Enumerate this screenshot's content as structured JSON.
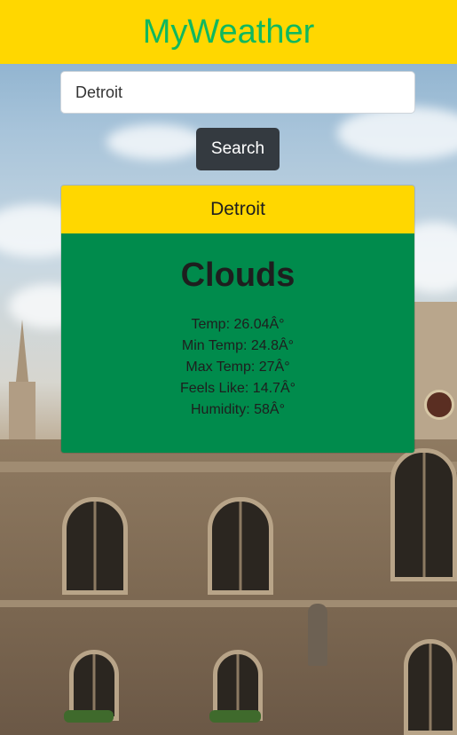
{
  "header": {
    "title": "MyWeather",
    "title_color": "#10b85e",
    "background": "#ffd700"
  },
  "search": {
    "value": "Detroit",
    "button_label": "Search"
  },
  "weather_card": {
    "city": "Detroit",
    "condition": "Clouds",
    "stats": [
      "Temp: 26.04Â°",
      "Min Temp: 24.8Â°",
      "Max Temp: 27Â°",
      "Feels Like: 14.7Â°",
      "Humidity: 58Â°"
    ],
    "header_color": "#ffd700",
    "body_color": "#008b4c"
  },
  "background_icon": "gothic-building-photo"
}
